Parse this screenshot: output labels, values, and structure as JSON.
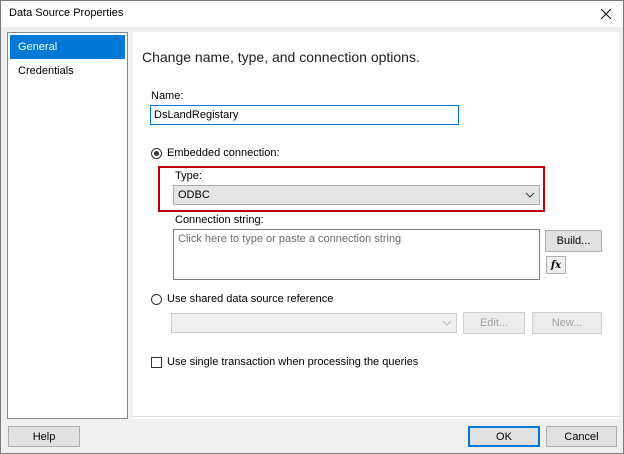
{
  "window": {
    "title": "Data Source Properties"
  },
  "sidebar": {
    "items": [
      {
        "label": "General",
        "selected": true
      },
      {
        "label": "Credentials",
        "selected": false
      }
    ]
  },
  "main": {
    "heading": "Change name, type, and connection options.",
    "name_label": "Name:",
    "name_value": "DsLandRegistary",
    "embedded_label": "Embedded connection:",
    "type_label": "Type:",
    "type_value": "ODBC",
    "connection_label": "Connection string:",
    "connection_placeholder": "Click here to type or paste a connection string",
    "build_label": "Build...",
    "fx_label": "fx",
    "shared_label": "Use shared data source reference",
    "edit_label": "Edit...",
    "new_label": "New...",
    "single_txn_label": "Use single transaction when processing the queries"
  },
  "footer": {
    "help_label": "Help",
    "ok_label": "OK",
    "cancel_label": "Cancel"
  },
  "colors": {
    "accent": "#0078d7",
    "highlight": "#c00000"
  }
}
